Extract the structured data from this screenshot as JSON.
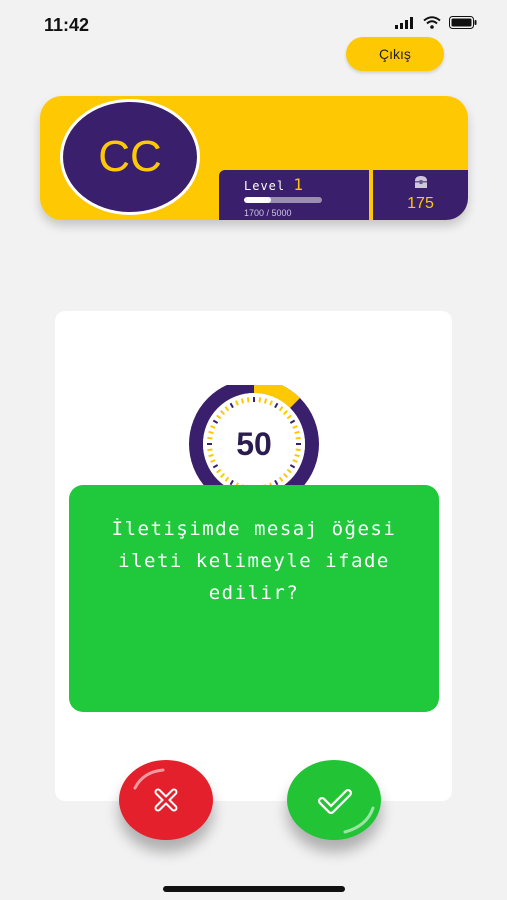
{
  "status_bar": {
    "time": "11:42"
  },
  "header": {
    "exit_label": "Çıkış"
  },
  "profile": {
    "initials": "CC",
    "level_label": "Level",
    "level_value": "1",
    "xp_text": "1700 / 5000",
    "xp_fraction": 0.34,
    "coins": "175"
  },
  "question": {
    "timer_value": "50",
    "timer_fraction": 0.125,
    "text_lines": [
      "İletişimde mesaj öğesi",
      "ileti kelimeyle ifade",
      "edilir?"
    ]
  },
  "colors": {
    "accent": "#fec903",
    "brand": "#3a1f6d",
    "correct": "#22c436",
    "wrong": "#e3202b",
    "panel": "#20c93c"
  },
  "icons": {
    "wrong": "close-icon",
    "correct": "check-icon",
    "coins": "treasure-chest-icon"
  }
}
